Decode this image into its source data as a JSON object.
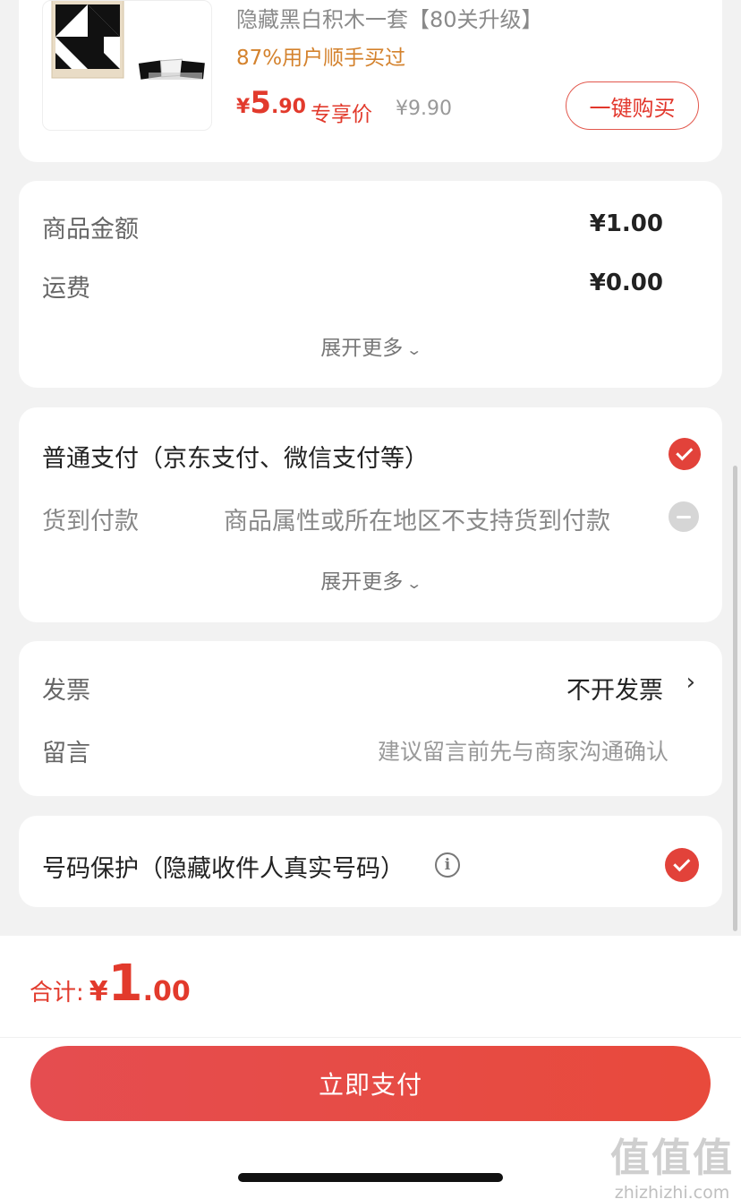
{
  "product": {
    "title": "隐藏黑白积木一套【80关升级】",
    "rate": "87%用户顺手买过",
    "price_yen": "¥",
    "price_int": "5",
    "price_dec": ".90",
    "price_tag": "专享价",
    "original_price": "¥9.90",
    "buy_button": "一键购买"
  },
  "amount": {
    "goods_label": "商品金额",
    "goods_value": "¥1.00",
    "shipping_label": "运费",
    "shipping_value": "¥0.00",
    "expand_label": "展开更多"
  },
  "payment": {
    "normal_label": "普通支付（京东支付、微信支付等）",
    "cod_label": "货到付款",
    "cod_note": "商品属性或所在地区不支持货到付款",
    "expand_label": "展开更多"
  },
  "invoice": {
    "invoice_label": "发票",
    "invoice_value": "不开发票",
    "message_label": "留言",
    "message_placeholder": "建议留言前先与商家沟通确认"
  },
  "protection": {
    "label": "号码保护（隐藏收件人真实号码）"
  },
  "bottom": {
    "total_label": "合计:",
    "total_yen": "¥",
    "total_int": "1",
    "total_dec": ".00",
    "pay_button": "立即支付"
  },
  "watermark": {
    "big": "值值值",
    "small": "zhizhizhi.com"
  },
  "colors": {
    "accent": "#e23a2c",
    "rate": "#d4822d",
    "background": "#f2f2f2"
  }
}
